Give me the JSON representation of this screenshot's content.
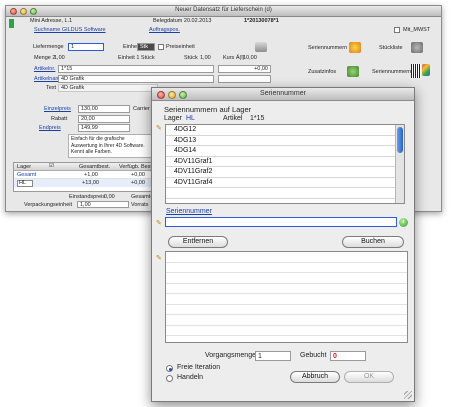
{
  "back_window": {
    "title": "Neuer Datensatz für Lieferschein (d)",
    "kunden_nr": "Mini Adresse, L.1",
    "belegdatum": "Belegdatum 20.02.2013",
    "beleg_nr": "1*20130078*1",
    "suchname": "Suchname GILDUS Software",
    "auftragspos": "Auftragspos.",
    "checkbox_label": "Mit_MWST",
    "liefermenge_label": "Liefermenge",
    "liefermenge_value": "1",
    "einheit_label": "Einheit",
    "einheit_value": "Stk",
    "preiseinheit_label": "Preiseinheit",
    "menge2_label": "Menge 2",
    "menge2_value": "1,00",
    "einheit2": "Einheit 1 Stück",
    "stueck_label": "Stück",
    "stueck_value": "1,00",
    "kurs_label": "Kurs Ä(l)",
    "kurs_value": "10,00",
    "seriennummer_label": "Seriennummern",
    "stueckliste_label": "Stückliste",
    "artikel_label": "Artikelnr.",
    "artikel_value": "1*15",
    "artikel_value2": "+0,00",
    "artikelname_label": "Artikelname",
    "artikelname_value": "4D Grafik",
    "text_label": "Text",
    "text_value": "4D Grafik",
    "zusatzinfos_label": "Zusatzinfos",
    "seriennummer_btn": "Seriennummern",
    "einzelpreis_label": "Einzelpreis",
    "einzelpreis_value": "130,00",
    "rabatt_label": "Rabatt",
    "rabatt_value": "20,00",
    "endpreis_label": "Endpreis",
    "endpreis_value": "149,99",
    "carrier_label": "Carrier",
    "description": "Einfach für die grafische Auswertung in Ihrer 4D Software. Kennt alle Farben.",
    "table_headers": [
      "Lager",
      "",
      "Gesamtbest.",
      "Verfügb. Best."
    ],
    "table_rows": [
      {
        "lager": "Gesamt",
        "gesamt": "+1,00",
        "verf": "+0,00"
      },
      {
        "lager": "HL",
        "gesamt": "+13,00",
        "verf": "+0,00"
      }
    ],
    "einstand_label": "Einstandspreis",
    "einstand_value": "0,00",
    "verpackung_label": "Verpackungseinheit",
    "verpackung_value": "1,00",
    "gesamt_label": "Gesamt-ge",
    "vorrats_label": "Vorrats"
  },
  "front_window": {
    "title": "Seriennummer",
    "header": "Seriennummern auf Lager",
    "lager_label": "Lager",
    "lager_value": "HL",
    "artikel_label": "Artikel",
    "artikel_value": "1*15",
    "serials": [
      "4DG12",
      "4DG13",
      "4DG14",
      "4DV11Graf1",
      "4DV11Graf2",
      "4DV11Graf4"
    ],
    "seriennummer_label": "Seriennummer",
    "input_value": "",
    "entfernen_btn": "Entfernen",
    "buchen_btn": "Buchen",
    "vorgangsmenge_label": "Vorgangsmenge",
    "vorgangsmenge_value": "1",
    "gebucht_label": "Gebucht",
    "gebucht_value": "0",
    "radio_1": "Freie Iteration",
    "radio_2": "Handeln",
    "abbruch_btn": "Abbruch",
    "ok_btn": "OK"
  },
  "colors": {
    "link_blue": "#1b3ea8",
    "gebucht_red": "#d4201c",
    "selected_blue": "#244fc4"
  }
}
